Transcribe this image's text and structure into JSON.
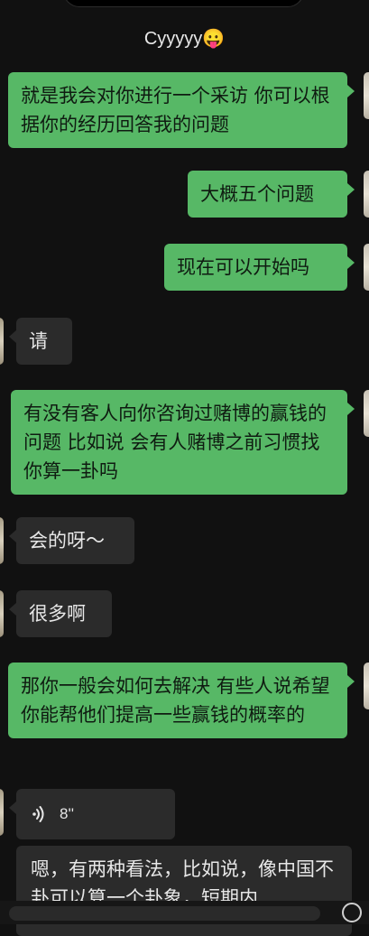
{
  "header": {
    "title": "Cyyyyy😛"
  },
  "messages": [
    {
      "side": "sent",
      "text": "就是我会对你进行一个采访 你可以根据你的经历回答我的问题"
    },
    {
      "side": "sent",
      "text": "大概五个问题"
    },
    {
      "side": "sent",
      "text": "现在可以开始吗"
    },
    {
      "side": "recv",
      "text": "请"
    },
    {
      "side": "sent",
      "text": "有没有客人向你咨询过赌博的赢钱的问题 比如说 会有人赌博之前习惯找你算一卦吗"
    },
    {
      "side": "recv",
      "text": "会的呀～"
    },
    {
      "side": "recv",
      "text": "很多啊"
    },
    {
      "side": "sent",
      "text": "那你一般会如何去解决 有些人说希望你能帮他们提高一些赢钱的概率的"
    }
  ],
  "voice": {
    "duration": "8''",
    "transcript": "嗯，有两种看法，比如说，像中国不卦可以算一个卦象，短期内"
  },
  "colors": {
    "background": "#111111",
    "sent_bubble": "#57b866",
    "recv_bubble": "#2b2b2b"
  }
}
